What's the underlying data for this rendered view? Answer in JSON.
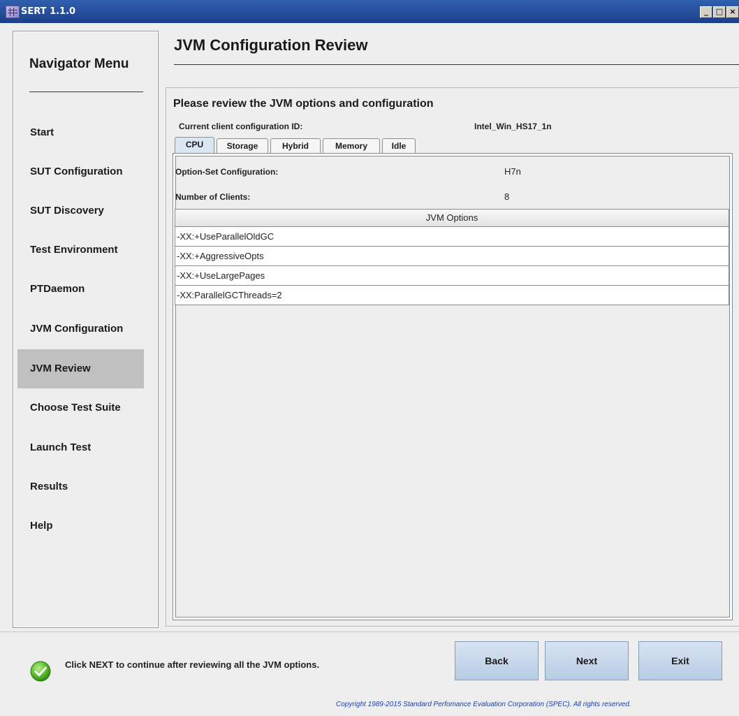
{
  "window": {
    "title": "SERT 1.1.0"
  },
  "nav": {
    "title": "Navigator Menu",
    "items": [
      {
        "label": "Start",
        "active": false
      },
      {
        "label": "SUT Configuration",
        "active": false
      },
      {
        "label": "SUT Discovery",
        "active": false
      },
      {
        "label": "Test Environment",
        "active": false
      },
      {
        "label": "PTDaemon",
        "active": false
      },
      {
        "label": "JVM Configuration",
        "active": false
      },
      {
        "label": "JVM Review",
        "active": true
      },
      {
        "label": "Choose Test Suite",
        "active": false
      },
      {
        "label": "Launch Test",
        "active": false
      },
      {
        "label": "Results",
        "active": false
      },
      {
        "label": "Help",
        "active": false
      }
    ]
  },
  "main": {
    "title": "JVM Configuration Review",
    "subheading": "Please review the JVM options and configuration",
    "config_label": "Current client configuration ID:",
    "config_value": "Intel_Win_HS17_1n",
    "tabs": [
      {
        "label": "CPU",
        "active": true
      },
      {
        "label": "Storage",
        "active": false
      },
      {
        "label": "Hybrid",
        "active": false
      },
      {
        "label": "Memory",
        "active": false
      },
      {
        "label": "Idle",
        "active": false
      }
    ],
    "option_set_label": "Option-Set Configuration:",
    "option_set_value": "H7n",
    "clients_label": "Number of Clients:",
    "clients_value": "8",
    "jvm_header": "JVM Options",
    "jvm_options": [
      "-XX:+UseParallelOldGC",
      "-XX:+AggressiveOpts",
      "-XX:+UseLargePages",
      "-XX:ParallelGCThreads=2"
    ]
  },
  "footer": {
    "status_text": "Click NEXT to continue after reviewing all the JVM options.",
    "back_label": "Back",
    "next_label": "Next",
    "exit_label": "Exit",
    "copyright": "Copyright 1989-2015 Standard Perfomance Evaluation Corporation (SPEC). All rights reserved."
  },
  "colors": {
    "titlebar": "#1c3f8a",
    "nav_active": "#c0c0c0",
    "button": "#b8cce4",
    "copyright": "#1a3fa6"
  }
}
